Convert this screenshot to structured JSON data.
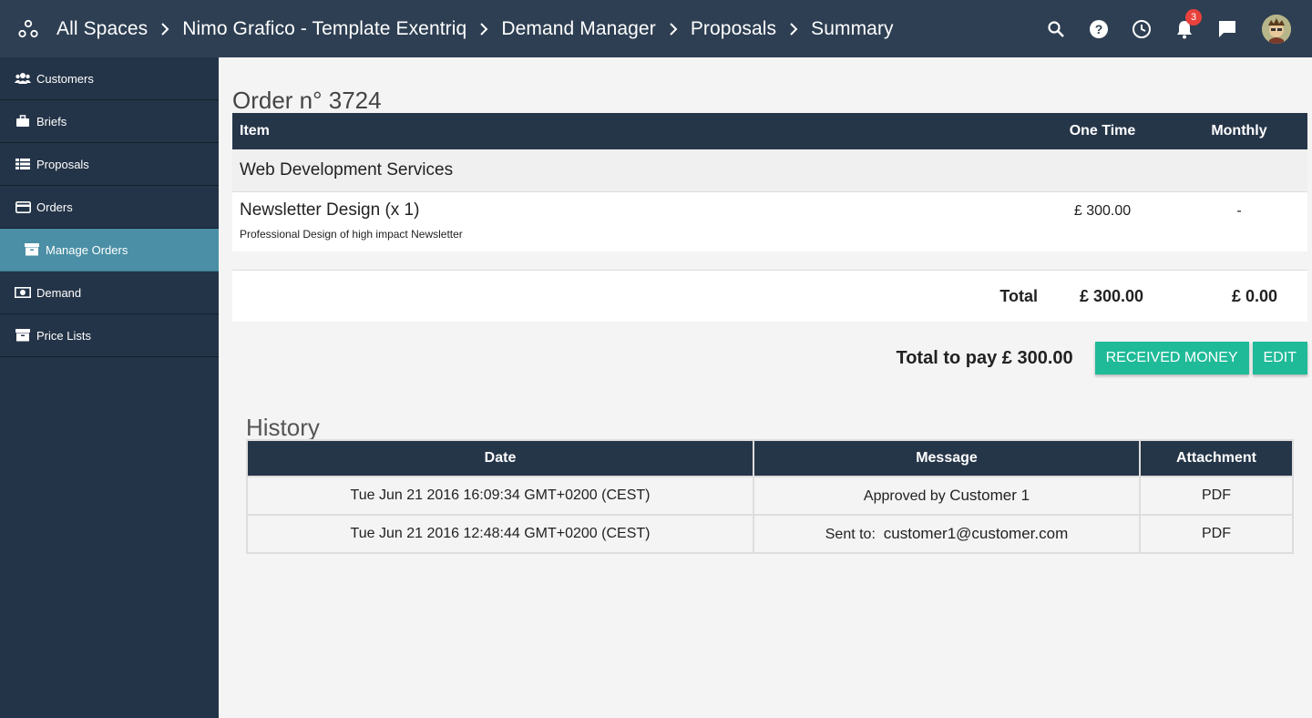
{
  "breadcrumb": [
    "All Spaces",
    "Nimo Grafico - Template Exentriq",
    "Demand Manager",
    "Proposals",
    "Summary"
  ],
  "header": {
    "notification_count": "3"
  },
  "sidebar": {
    "items": [
      {
        "label": "Customers",
        "icon": "users-icon"
      },
      {
        "label": "Briefs",
        "icon": "briefcase-icon"
      },
      {
        "label": "Proposals",
        "icon": "list-icon"
      },
      {
        "label": "Orders",
        "icon": "credit-card-icon"
      },
      {
        "label": "Manage Orders",
        "icon": "archive-icon"
      },
      {
        "label": "Demand",
        "icon": "money-icon"
      },
      {
        "label": "Price Lists",
        "icon": "archive-icon"
      }
    ]
  },
  "order": {
    "title": "Order n° 3724",
    "columns": {
      "item": "Item",
      "one_time": "One Time",
      "monthly": "Monthly"
    },
    "section": "Web Development Services",
    "item": {
      "name": "Newsletter Design (x 1)",
      "description": "Professional Design of high impact Newsletter",
      "one_time": "£ 300.00",
      "monthly": "-"
    },
    "total": {
      "label": "Total",
      "one_time": "£ 300.00",
      "monthly": "£ 0.00"
    },
    "total_to_pay": "Total to pay £ 300.00",
    "buttons": {
      "received": "RECEIVED MONEY",
      "edit": "EDIT"
    }
  },
  "history": {
    "title": "History",
    "columns": {
      "date": "Date",
      "message": "Message",
      "attachment": "Attachment"
    },
    "rows": [
      {
        "date": "Tue Jun 21 2016 16:09:34 GMT+0200 (CEST)",
        "message_prefix": "Approved by",
        "message_value": "Customer 1",
        "attachment": "PDF"
      },
      {
        "date": "Tue Jun 21 2016 12:48:44 GMT+0200 (CEST)",
        "message_prefix": "Sent to:",
        "message_value": "customer1@customer.com",
        "attachment": "PDF"
      }
    ]
  },
  "colors": {
    "topbar": "#2e3f53",
    "sidebar": "#243448",
    "sidebar_active": "#4a8fa5",
    "table_header": "#263649",
    "button": "#1fba98",
    "badge": "#e8413c"
  }
}
